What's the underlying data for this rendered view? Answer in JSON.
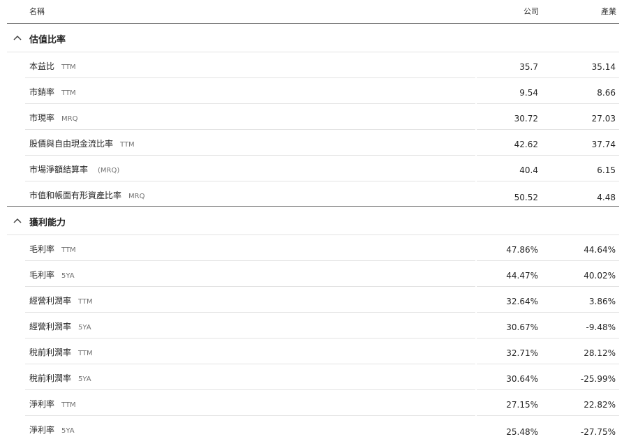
{
  "header": {
    "name": "名稱",
    "company": "公司",
    "industry": "產業"
  },
  "sections": [
    {
      "title": "估值比率",
      "rows": [
        {
          "label": "本益比",
          "period": "TTM",
          "company": "35.7",
          "industry": "35.14"
        },
        {
          "label": "市銷率",
          "period": "TTM",
          "company": "9.54",
          "industry": "8.66"
        },
        {
          "label": "市現率",
          "period": "MRQ",
          "company": "30.72",
          "industry": "27.03"
        },
        {
          "label": "股價與自由現金流比率",
          "period": "TTM",
          "company": "42.62",
          "industry": "37.74"
        },
        {
          "label": "市場淨額結算率",
          "period": "(MRQ)",
          "company": "40.4",
          "industry": "6.15"
        },
        {
          "label": "市值和帳面有形資產比率",
          "period": "MRQ",
          "company": "50.52",
          "industry": "4.48"
        }
      ]
    },
    {
      "title": "獲利能力",
      "rows": [
        {
          "label": "毛利率",
          "period": "TTM",
          "company": "47.86%",
          "industry": "44.64%"
        },
        {
          "label": "毛利率",
          "period": "5YA",
          "company": "44.47%",
          "industry": "40.02%"
        },
        {
          "label": "經營利潤率",
          "period": "TTM",
          "company": "32.64%",
          "industry": "3.86%"
        },
        {
          "label": "經營利潤率",
          "period": "5YA",
          "company": "30.67%",
          "industry": "-9.48%"
        },
        {
          "label": "稅前利潤率",
          "period": "TTM",
          "company": "32.71%",
          "industry": "28.12%"
        },
        {
          "label": "稅前利潤率",
          "period": "5YA",
          "company": "30.64%",
          "industry": "-25.99%"
        },
        {
          "label": "淨利率",
          "period": "TTM",
          "company": "27.15%",
          "industry": "22.82%"
        },
        {
          "label": "淨利率",
          "period": "5YA",
          "company": "25.48%",
          "industry": "-27.75%"
        }
      ]
    }
  ]
}
